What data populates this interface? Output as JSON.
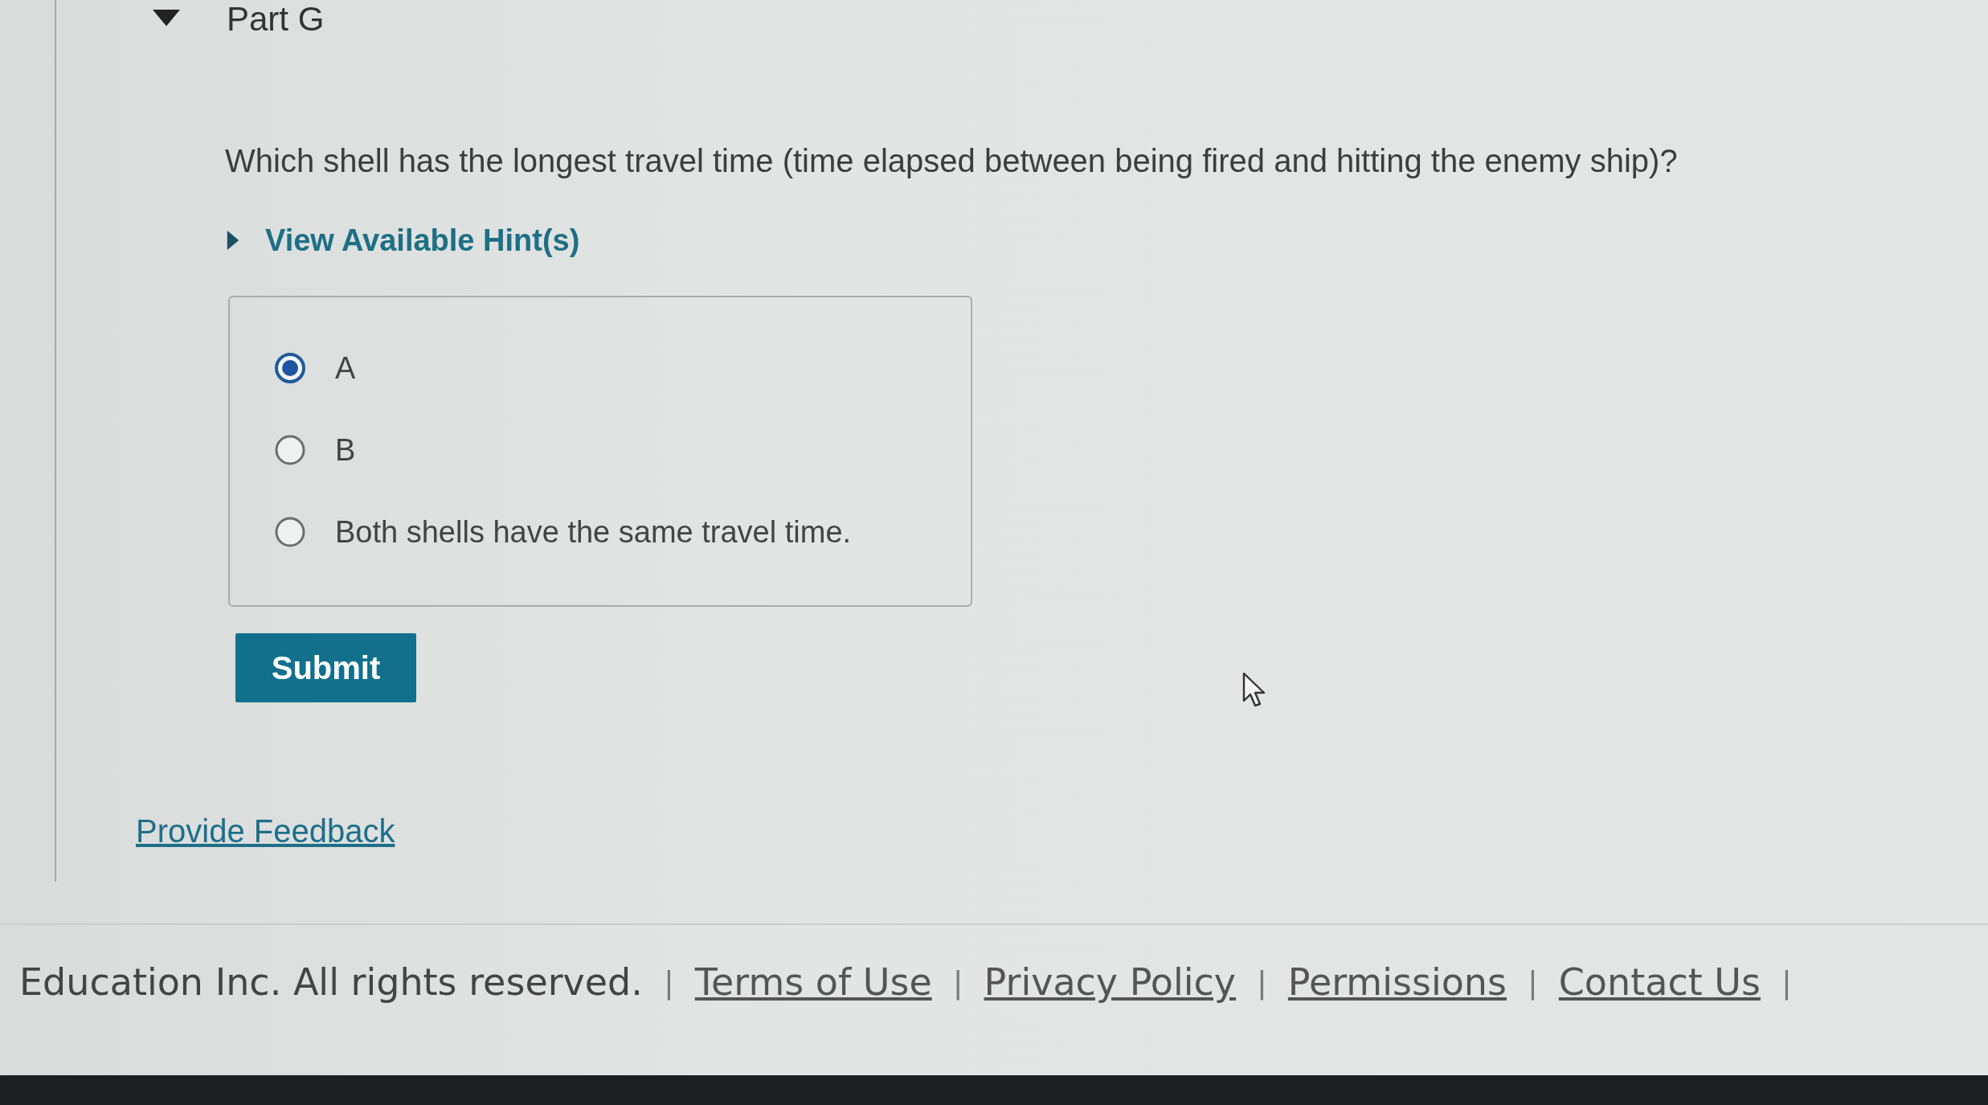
{
  "part": {
    "title": "Part G",
    "expanded": true
  },
  "question": "Which shell has the longest travel time (time elapsed between being fired and hitting the enemy ship)?",
  "hint": {
    "label": "View Available Hint(s)",
    "expanded": false
  },
  "options": [
    {
      "label": "A",
      "selected": true
    },
    {
      "label": "B",
      "selected": false
    },
    {
      "label": "Both shells have the same travel time.",
      "selected": false
    }
  ],
  "submit_button": "Submit",
  "feedback_link": "Provide Feedback",
  "footer": [
    {
      "kind": "text",
      "label": "Education Inc. All rights reserved."
    },
    {
      "kind": "separator",
      "label": "|"
    },
    {
      "kind": "link",
      "label": "Terms of Use"
    },
    {
      "kind": "separator",
      "label": "|"
    },
    {
      "kind": "link",
      "label": "Privacy Policy"
    },
    {
      "kind": "separator",
      "label": "|"
    },
    {
      "kind": "link",
      "label": "Permissions"
    },
    {
      "kind": "separator",
      "label": "|"
    },
    {
      "kind": "link",
      "label": "Contact Us"
    },
    {
      "kind": "separator",
      "label": "|"
    }
  ]
}
